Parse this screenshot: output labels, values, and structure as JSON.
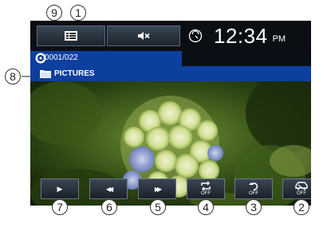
{
  "clock": {
    "time": "12:34",
    "ampm": "PM"
  },
  "track": {
    "counter": "0001/022"
  },
  "folder": {
    "name": "PICTURES"
  },
  "controls": {
    "play": "▶",
    "rewind": "◀◀",
    "forward": "▶▶",
    "repeat_state": "OFF",
    "rotate_state": "OFF",
    "mode_state": "OFF"
  },
  "callouts": {
    "c1": "1",
    "c2": "2",
    "c3": "3",
    "c4": "4",
    "c5": "5",
    "c6": "6",
    "c7": "7",
    "c8": "8",
    "c9": "9"
  },
  "icons": [
    "list-icon",
    "mute-icon",
    "clock-icon",
    "disc-icon",
    "folder-icon",
    "play-icon",
    "rewind-icon",
    "fast-forward-icon",
    "repeat-icon",
    "rotate-icon",
    "car-icon"
  ]
}
